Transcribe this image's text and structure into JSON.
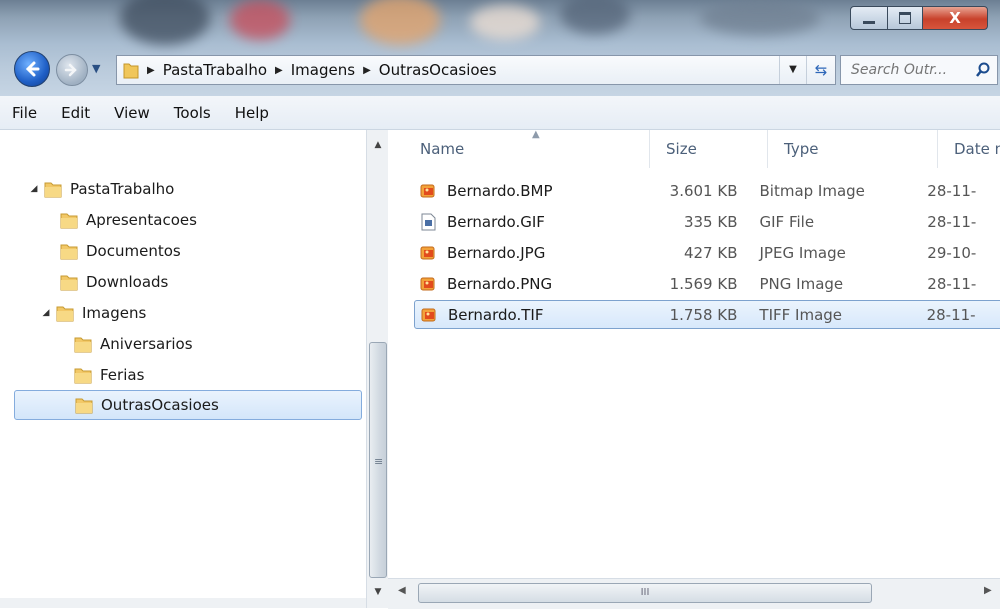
{
  "window": {
    "minimize_glyph": "minimize-icon",
    "maximize_glyph": "maximize-icon",
    "close_glyph": "close-icon",
    "close_label": "X"
  },
  "addressbar": {
    "crumbs": [
      "PastaTrabalho",
      "Imagens",
      "OutrasOcasioes"
    ],
    "dropdown_icon": "chevron-down-icon",
    "refresh_icon": "refresh-icon"
  },
  "search": {
    "placeholder": "Search Outr...",
    "icon": "search-icon"
  },
  "menu": {
    "items": [
      "File",
      "Edit",
      "View",
      "Tools",
      "Help"
    ]
  },
  "tree": {
    "items": [
      {
        "label": "PastaTrabalho",
        "expanded": true
      },
      {
        "label": "Apresentacoes"
      },
      {
        "label": "Documentos"
      },
      {
        "label": "Downloads"
      },
      {
        "label": "Imagens",
        "expanded": true
      },
      {
        "label": "Aniversarios"
      },
      {
        "label": "Ferias"
      },
      {
        "label": "OutrasOcasioes",
        "selected": true
      }
    ]
  },
  "filelist": {
    "columns": [
      "Name",
      "Size",
      "Type",
      "Date m"
    ],
    "rows": [
      {
        "name": "Bernardo.BMP",
        "size": "3.601 KB",
        "type": "Bitmap Image",
        "date": "28-11-",
        "icon": "image-file-icon"
      },
      {
        "name": "Bernardo.GIF",
        "size": "335 KB",
        "type": "GIF File",
        "date": "28-11-",
        "icon": "gif-file-icon"
      },
      {
        "name": "Bernardo.JPG",
        "size": "427 KB",
        "type": "JPEG Image",
        "date": "29-10-",
        "icon": "image-file-icon"
      },
      {
        "name": "Bernardo.PNG",
        "size": "1.569 KB",
        "type": "PNG Image",
        "date": "28-11-",
        "icon": "image-file-icon"
      },
      {
        "name": "Bernardo.TIF",
        "size": "1.758 KB",
        "type": "TIFF Image",
        "date": "28-11-",
        "icon": "image-file-icon",
        "selected": true
      }
    ]
  },
  "hscroll": {
    "grip_label": "III"
  },
  "vscroll": {
    "grip_label": "≡"
  }
}
